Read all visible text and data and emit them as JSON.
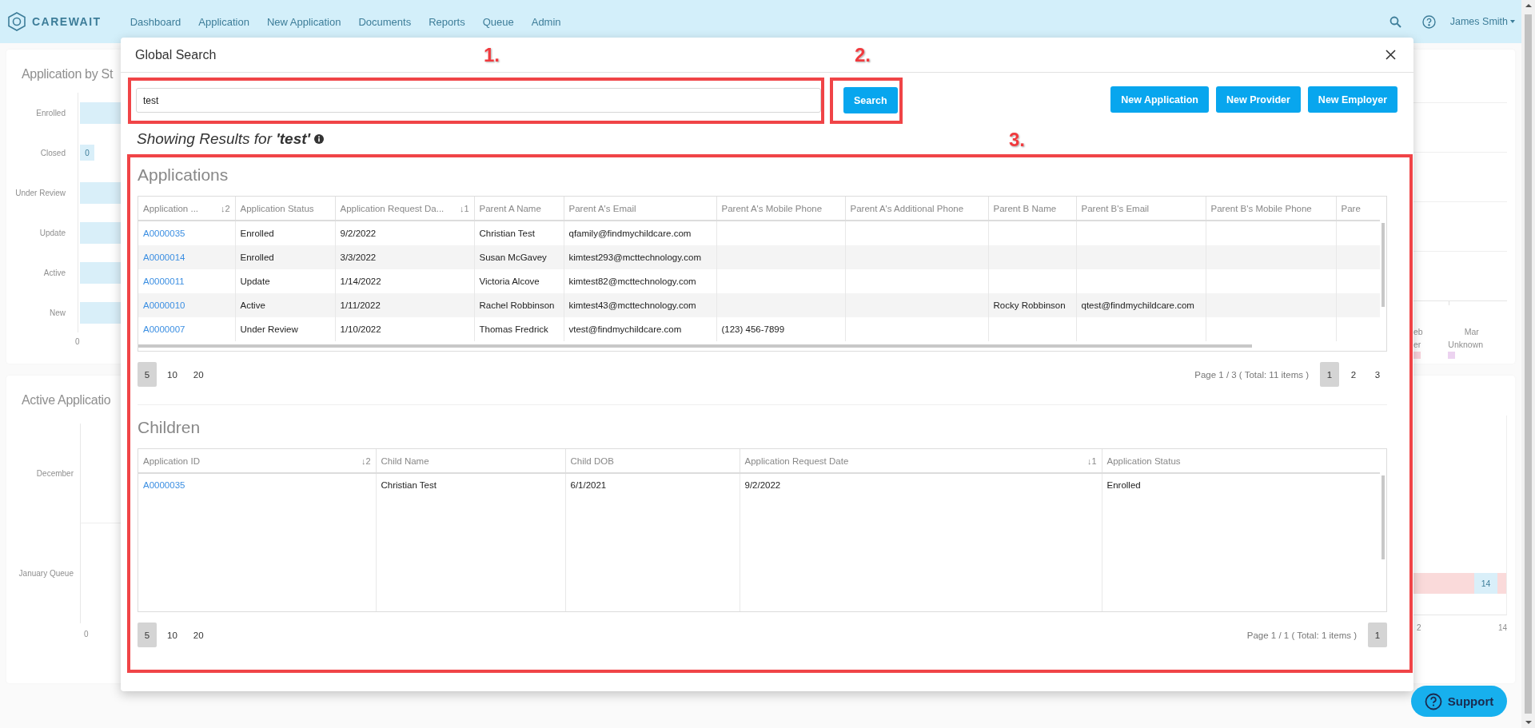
{
  "navbar": {
    "brand": "CAREWAIT",
    "menu": [
      "Dashboard",
      "Application",
      "New Application",
      "Documents",
      "Reports",
      "Queue",
      "Admin"
    ],
    "user": "James Smith"
  },
  "status_chart_card": {
    "title": "Application by St",
    "bars": [
      {
        "label": "Enrolled"
      },
      {
        "label": "Closed",
        "value": "0"
      },
      {
        "label": "Under Review"
      },
      {
        "label": "Update"
      },
      {
        "label": "Active"
      },
      {
        "label": "New"
      }
    ],
    "x_tick": "0",
    "right_x_ticks": [
      "eb",
      "Mar"
    ],
    "legend": [
      {
        "label": "er",
        "color": "#f9d3dc"
      },
      {
        "label": "Unknown",
        "color": "#ecd3f0"
      }
    ]
  },
  "active_chart_card": {
    "title": "Active Applicatio",
    "rows": [
      "December",
      "January Queue"
    ],
    "x_tick": "0",
    "right_bar_value": "14",
    "right_x_ticks": [
      "2",
      "14"
    ]
  },
  "global_search": {
    "title": "Global Search",
    "annotations": [
      "1.",
      "2.",
      "3."
    ],
    "search": {
      "value": "test"
    },
    "search_button": "Search",
    "actions": [
      "New Application",
      "New Provider",
      "New Employer"
    ],
    "results_caption": "Showing Results for **'test'**",
    "applications": {
      "title": "Applications",
      "columns": [
        {
          "label": "Application ...",
          "sort": "↓2"
        },
        {
          "label": "Application Status"
        },
        {
          "label": "Application Request Da...",
          "sort": "↓1"
        },
        {
          "label": "Parent A Name"
        },
        {
          "label": "Parent A's Email"
        },
        {
          "label": "Parent A's Mobile Phone"
        },
        {
          "label": "Parent A's Additional Phone"
        },
        {
          "label": "Parent B Name"
        },
        {
          "label": "Parent B's Email"
        },
        {
          "label": "Parent B's Mobile Phone"
        },
        {
          "label": "Pare"
        }
      ],
      "rows": [
        [
          "A0000035",
          "Enrolled",
          "9/2/2022",
          "Christian Test",
          "qfamily@findmychildcare.com",
          null,
          null,
          null,
          null,
          null,
          null
        ],
        [
          "A0000014",
          "Enrolled",
          "3/3/2022",
          "Susan McGavey",
          "kimtest293@mcttechnology.com",
          null,
          null,
          null,
          null,
          null,
          null
        ],
        [
          "A0000011",
          "Update",
          "1/14/2022",
          "Victoria Alcove",
          "kimtest82@mcttechnology.com",
          null,
          null,
          null,
          null,
          null,
          null
        ],
        [
          "A0000010",
          "Active",
          "1/11/2022",
          "Rachel Robbinson",
          "kimtest43@mcttechnology.com",
          null,
          null,
          "Rocky Robbinson",
          "qtest@findmychildcare.com",
          null,
          null
        ],
        [
          "A0000007",
          "Under Review",
          "1/10/2022",
          "Thomas Fredrick",
          "vtest@findmychildcare.com",
          "(123) 456-7899",
          null,
          null,
          null,
          null,
          null
        ]
      ],
      "page_sizes": [
        {
          "label": "5",
          "selected": true
        },
        {
          "label": "10",
          "selected": false
        },
        {
          "label": "20",
          "selected": false
        }
      ],
      "page_info": "Page 1 / 3 ( Total: 11 items )",
      "pages": [
        {
          "label": "1",
          "selected": true
        },
        {
          "label": "2",
          "selected": false
        },
        {
          "label": "3",
          "selected": false
        }
      ]
    },
    "children": {
      "title": "Children",
      "columns": [
        {
          "label": "Application ID",
          "sort": "↓2"
        },
        {
          "label": "Child Name"
        },
        {
          "label": "Child DOB"
        },
        {
          "label": "Application Request Date",
          "sort": "↓1"
        },
        {
          "label": "Application Status"
        }
      ],
      "rows": [
        [
          "A0000035",
          "Christian Test",
          "6/1/2021",
          "9/2/2022",
          "Enrolled"
        ]
      ],
      "page_sizes": [
        {
          "label": "5",
          "selected": true
        },
        {
          "label": "10",
          "selected": false
        },
        {
          "label": "20",
          "selected": false
        }
      ],
      "page_info": "Page 1 / 1 ( Total: 1 items )",
      "pages": [
        {
          "label": "1",
          "selected": true
        }
      ]
    }
  },
  "support_button": "Support"
}
